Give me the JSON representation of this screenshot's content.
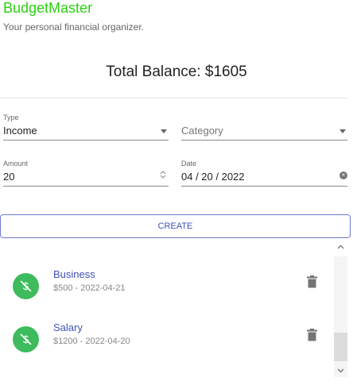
{
  "app": {
    "title": "BudgetMaster",
    "subtitle": "Your personal financial organizer."
  },
  "balance": {
    "text": "Total Balance: $1605"
  },
  "form": {
    "type": {
      "label": "Type",
      "value": "Income"
    },
    "category": {
      "placeholder": "Category"
    },
    "amount": {
      "label": "Amount",
      "value": "20"
    },
    "date": {
      "label": "Date",
      "value": "04 / 20 / 2022"
    },
    "create_label": "CREATE"
  },
  "transactions": [
    {
      "name": "Business",
      "detail": "$500 - 2022-04-21",
      "icon": "dollar-off-icon"
    },
    {
      "name": "Salary",
      "detail": "$1200 - 2022-04-20",
      "icon": "dollar-off-icon"
    }
  ],
  "colors": {
    "brand": "#2ad10f",
    "accent": "#3f51b5",
    "avatar": "#3dbb5d"
  }
}
